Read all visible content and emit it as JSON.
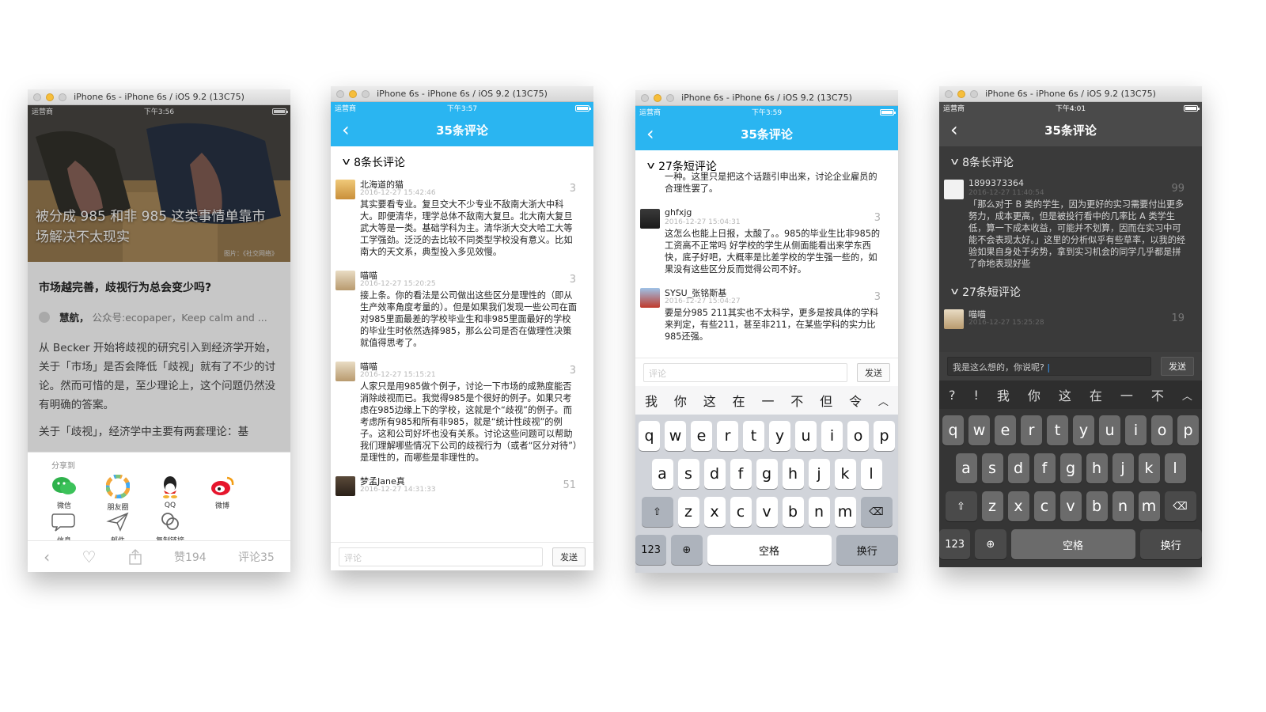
{
  "simulator_title": "iPhone 6s - iPhone 6s / iOS 9.2 (13C75)",
  "carrier": "运营商",
  "colors": {
    "nav_blue": "#2ab5f1",
    "dark_bg": "#3a3a3a",
    "dark_bar": "#4a4a4a"
  },
  "phone1": {
    "time": "下午3:56",
    "hero_title": "被分成 985 和非 985 这类事情单靠市场解决不太现实",
    "hero_credit": "图片：《社交网络》",
    "article_title": "市场越完善，歧视行为总会变少吗?",
    "author_name": "慧航，",
    "author_desc": "公众号:ecopaper，Keep calm and ...",
    "body": "从 Becker 开始将歧视的研究引入到经济学开始，关于「市场」是否会降低「歧视」就有了不少的讨论。然而可惜的是，至少理论上，这个问题仍然没有明确的答案。",
    "body_cut": "关于「歧视」，经济学中主要有两套理论：基",
    "share_label": "分享到",
    "share_items": [
      {
        "label": "微信",
        "icon": "wechat-icon"
      },
      {
        "label": "朋友圈",
        "icon": "moments-icon"
      },
      {
        "label": "QQ",
        "icon": "qq-icon"
      },
      {
        "label": "微博",
        "icon": "weibo-icon"
      },
      {
        "label": "信息",
        "icon": "message-icon"
      },
      {
        "label": "邮件",
        "icon": "mail-icon"
      },
      {
        "label": "复制链接",
        "icon": "link-icon"
      }
    ],
    "toolbar": {
      "likes": "赞194",
      "comments": "评论35"
    }
  },
  "phone2": {
    "time": "下午3:57",
    "nav_title": "35条评论",
    "section": "8条长评论",
    "comments": [
      {
        "name": "北海道的猫",
        "time": "2016-12-27 15:42:46",
        "likes": "3",
        "text": "其实要看专业。复旦交大不少专业不敌南大浙大中科大。即便清华，理学总体不敌南大复旦。北大南大复旦武大等是一类。基础学科为主。清华浙大交大哈工大等工学强劲。泛泛的去比较不同类型学校没有意义。比如南大的天文系，典型投入多见效慢。"
      },
      {
        "name": "喵喵",
        "time": "2016-12-27 15:20:25",
        "likes": "3",
        "text": "接上条。你的看法是公司做出这些区分是理性的（即从生产效率角度考量的）。但是如果我们发现一些公司在面对985里面最差的学校毕业生和非985里面最好的学校的毕业生时依然选择985，那么公司是否在做理性决策就值得思考了。"
      },
      {
        "name": "喵喵",
        "time": "2016-12-27 15:15:21",
        "likes": "3",
        "text": "人家只是用985做个例子，讨论一下市场的成熟度能否消除歧视而已。我觉得985是个很好的例子。如果只考虑在985边缘上下的学校，这就是个“歧视”的例子。而考虑所有985和所有非985，就是“统计性歧视”的例子。这和公司好坏也没有关系。讨论这些问题可以帮助我们理解哪些情况下公司的歧视行为（或者“区分对待”）是理性的，而哪些是非理性的。"
      },
      {
        "name": "梦孟Jane真",
        "time": "2016-12-27 14:31:33",
        "likes": "51",
        "text": ""
      }
    ],
    "input_placeholder": "评论",
    "send": "发送"
  },
  "phone3": {
    "time": "下午3:59",
    "nav_title": "35条评论",
    "section": "27条短评论",
    "partial_text": "一种。这里只是把这个话题引申出来，讨论企业雇员的合理性罢了。",
    "comments": [
      {
        "name": "ghfxjg",
        "time": "2016-12-27 15:04:31",
        "likes": "3",
        "text": "这怎么也能上日报，太酸了。。985的毕业生比非985的工资高不正常吗 好学校的学生从侧面能看出来学东西快，底子好吧，大概率是比差学校的学生强一些的，如果没有这些区分反而觉得公司不好。"
      },
      {
        "name": "SYSU_张铭斯基",
        "time": "2016-12-27 15:04:27",
        "likes": "3",
        "text": "要是分985 211其实也不太科学，更多是按具体的学科来判定，有些211，甚至非211，在某些学科的实力比985还强。"
      }
    ],
    "input_placeholder": "评论",
    "send": "发送",
    "candidates": [
      "我",
      "你",
      "这",
      "在",
      "一",
      "不",
      "但",
      "令"
    ],
    "rows": [
      [
        "q",
        "w",
        "e",
        "r",
        "t",
        "y",
        "u",
        "i",
        "o",
        "p"
      ],
      [
        "a",
        "s",
        "d",
        "f",
        "g",
        "h",
        "j",
        "k",
        "l"
      ],
      [
        "z",
        "x",
        "c",
        "v",
        "b",
        "n",
        "m"
      ]
    ],
    "key_123": "123",
    "key_space": "空格",
    "key_return": "换行"
  },
  "phone4": {
    "time": "下午4:01",
    "nav_title": "35条评论",
    "section_long": "8条长评论",
    "long_comment": {
      "name": "1899373364",
      "time": "2016-12-27 11:40:54",
      "likes": "99",
      "text": "「那么对于 B 类的学生，因为更好的实习需要付出更多努力，成本更高，但是被投行看中的几率比 A 类学生低，算一下成本收益，可能并不划算，因而在实习中可能不会表现太好。」这里的分析似乎有些草率，以我的经验如果自身处于劣势，拿到实习机会的同学几乎都是拼了命地表现好些"
    },
    "section_short": "27条短评论",
    "short_comment": {
      "name": "喵喵",
      "time": "2016-12-27 15:25:28",
      "likes": "19"
    },
    "input_value": "我是这么想的，你说呢?",
    "send": "发送",
    "candidates": [
      "?",
      "!",
      "我",
      "你",
      "这",
      "在",
      "一",
      "不"
    ],
    "rows": [
      [
        "q",
        "w",
        "e",
        "r",
        "t",
        "y",
        "u",
        "i",
        "o",
        "p"
      ],
      [
        "a",
        "s",
        "d",
        "f",
        "g",
        "h",
        "j",
        "k",
        "l"
      ],
      [
        "z",
        "x",
        "c",
        "v",
        "b",
        "n",
        "m"
      ]
    ],
    "key_123": "123",
    "key_space": "空格",
    "key_return": "换行"
  }
}
